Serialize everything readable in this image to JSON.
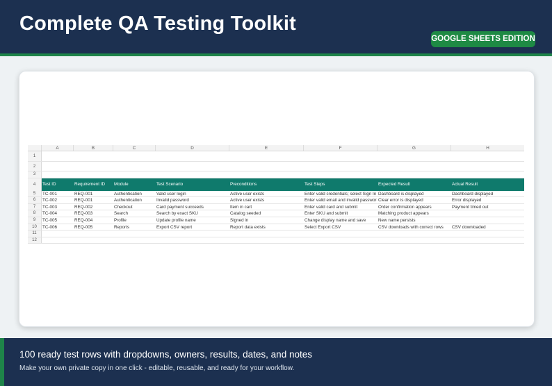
{
  "header": {
    "title": "Complete QA Testing Toolkit",
    "badge": "GOOGLE SHEETS EDITION"
  },
  "sheet": {
    "column_letters": [
      "A",
      "B",
      "C",
      "D",
      "E",
      "F",
      "G",
      "H"
    ],
    "row_numbers": [
      "1",
      "2",
      "3",
      "4",
      "5",
      "6",
      "7",
      "8",
      "9",
      "10",
      "11",
      "12"
    ],
    "headers": [
      "Test ID",
      "Requirement ID",
      "Module",
      "Test Scenario",
      "Preconditions",
      "Test Steps",
      "Expected Result",
      "Actual Result"
    ],
    "rows": [
      [
        "TC-001",
        "REQ-001",
        "Authentication",
        "Valid user login",
        "Active user exists",
        "Enter valid credentials; select Sign In",
        "Dashboard is displayed",
        "Dashboard displayed"
      ],
      [
        "TC-002",
        "REQ-001",
        "Authentication",
        "Invalid password",
        "Active user exists",
        "Enter valid email and invalid password",
        "Clear error is displayed",
        "Error displayed"
      ],
      [
        "TC-003",
        "REQ-002",
        "Checkout",
        "Card payment succeeds",
        "Item in cart",
        "Enter valid card and submit",
        "Order confirmation appears",
        "Payment timed out"
      ],
      [
        "TC-004",
        "REQ-003",
        "Search",
        "Search by exact SKU",
        "Catalog seeded",
        "Enter SKU and submit",
        "Matching product appears",
        ""
      ],
      [
        "TC-005",
        "REQ-004",
        "Profile",
        "Update profile name",
        "Signed in",
        "Change display name and save",
        "New name persists",
        ""
      ],
      [
        "TC-006",
        "REQ-005",
        "Reports",
        "Export CSV report",
        "Report data exists",
        "Select Export CSV",
        "CSV downloads with correct rows",
        "CSV downloaded"
      ]
    ]
  },
  "footer": {
    "headline": "100 ready test rows with dropdowns, owners, results, dates, and notes",
    "subline": "Make your own private copy in one click - editable, reusable, and ready for your workflow."
  },
  "colors": {
    "navy": "#1c3050",
    "green": "#1e8a44",
    "teal_header": "#0f7a6c"
  }
}
